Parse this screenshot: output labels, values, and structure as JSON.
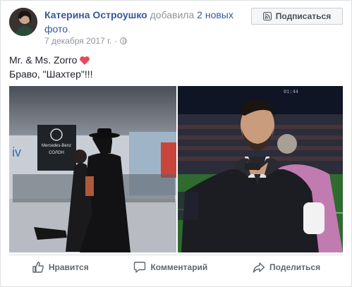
{
  "post": {
    "author": "Катерина Остроушко",
    "action_text": " добавила ",
    "photos_link": "2 новых фото",
    "period": ".",
    "date": "7 декабря 2017 г.",
    "dot": "·",
    "privacy_icon": "globe-icon",
    "subscribe_label": "Подписаться",
    "subscribe_icon": "rss-feed-icon",
    "text_line1": "Mr. & Ms. Zorro",
    "heart_icon": "heart-icon",
    "heart_color": "#e8485e",
    "text_line2": "Браво, \"Шахтер\"!!!"
  },
  "photo1": {
    "sign_brand": "Mercedes-Benz",
    "sign_sub": "СОЛОН",
    "wall_letters": "iv"
  },
  "photo2": {
    "scoreboard": "01:44"
  },
  "actions": {
    "like_label": "Нравится",
    "like_icon": "thumbs-up-icon",
    "comment_label": "Комментарий",
    "comment_icon": "speech-bubble-icon",
    "share_label": "Поделиться",
    "share_icon": "share-arrow-icon"
  },
  "colors": {
    "link": "#365899",
    "meta": "#90949c",
    "text": "#1d2129",
    "action": "#606770"
  }
}
